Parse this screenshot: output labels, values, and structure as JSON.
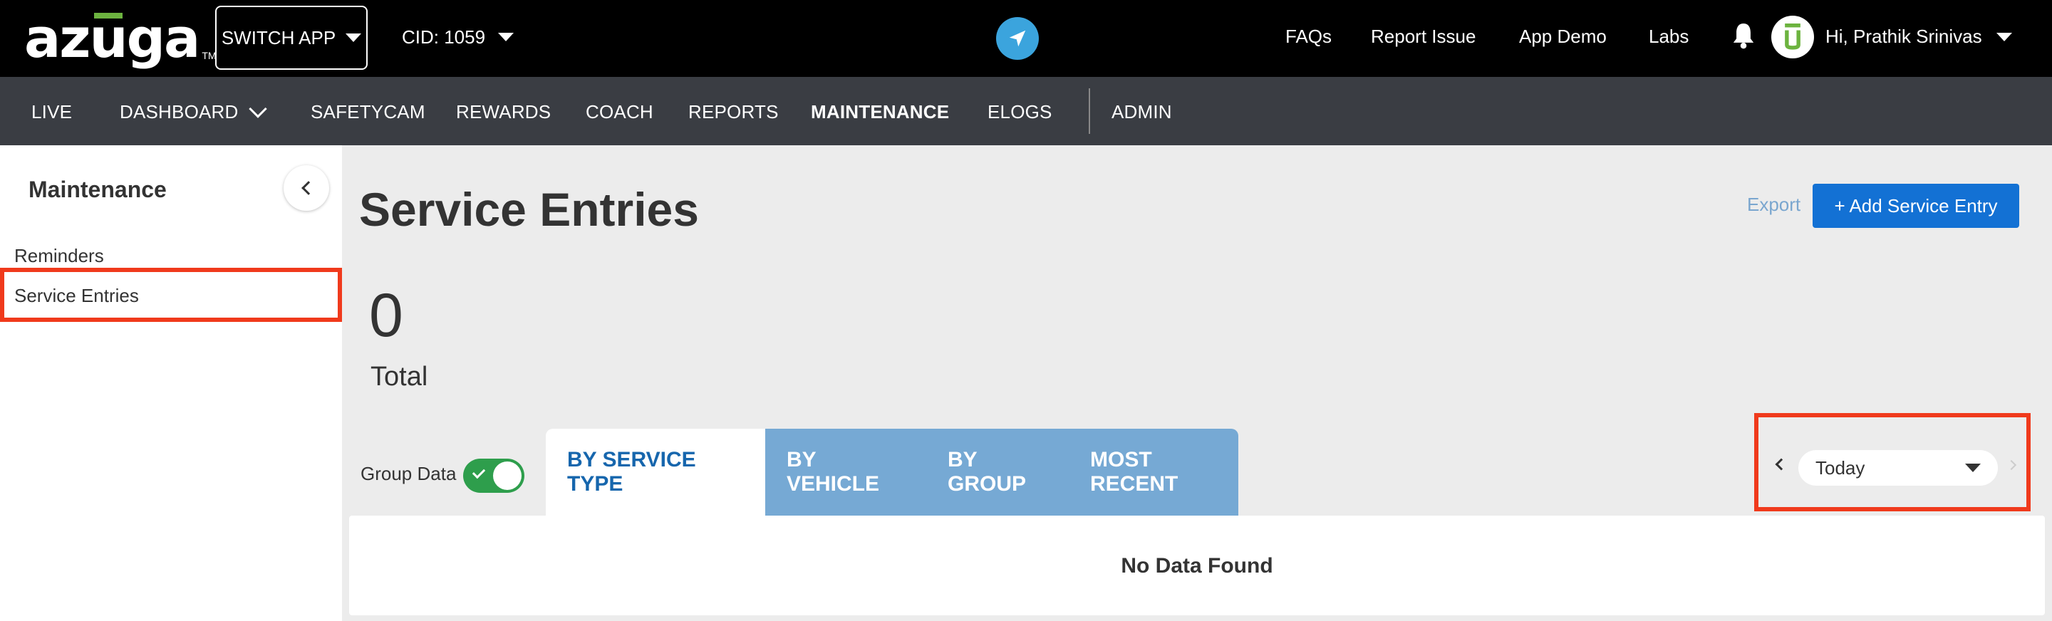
{
  "brand": {
    "logo_text": "azuga",
    "logo_tm": "TM",
    "accent": "#6cb33f"
  },
  "topbar": {
    "switch_app": "SWITCH APP",
    "cid": "CID: 1059",
    "links": {
      "faqs": "FAQs",
      "report_issue": "Report Issue",
      "app_demo": "App Demo",
      "labs": "Labs"
    },
    "user_greeting": "Hi, Prathik Srinivas"
  },
  "mainnav": {
    "live": "LIVE",
    "dashboard": "DASHBOARD",
    "safetycam": "SAFETYCAM",
    "rewards": "REWARDS",
    "coach": "COACH",
    "reports": "REPORTS",
    "maintenance": "MAINTENANCE",
    "elogs": "ELOGS",
    "admin": "ADMIN"
  },
  "sidebar": {
    "title": "Maintenance",
    "items": [
      {
        "label": "Reminders"
      },
      {
        "label": "Service Entries",
        "selected": true
      }
    ]
  },
  "main": {
    "title": "Service Entries",
    "export": "Export",
    "add_button": "+ Add Service Entry",
    "total_value": "0",
    "total_label": "Total",
    "group_data_label": "Group Data",
    "group_data_on": true,
    "tabs": [
      {
        "label": "BY SERVICE TYPE",
        "active": true
      },
      {
        "label": "BY VEHICLE"
      },
      {
        "label": "BY GROUP"
      },
      {
        "label": "MOST RECENT"
      }
    ],
    "date_range": "Today",
    "empty_message": "No Data Found"
  },
  "colors": {
    "primary_button": "#1371d4",
    "tab_inactive": "#76a9d4",
    "toggle_on": "#2e9e4c",
    "highlight": "#f03a1c"
  }
}
